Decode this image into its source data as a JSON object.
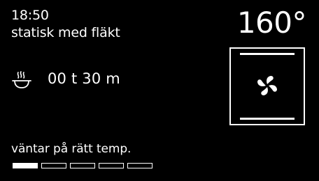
{
  "status_bar": {
    "time": "18:50",
    "mode": "statisk med fläkt",
    "temperature": "160°"
  },
  "timer": {
    "icon": "cooking-pot-steam-icon",
    "duration": "00 t 30 m"
  },
  "oven_display": {
    "heating_icon": "fan-icon",
    "top_element_on": true,
    "bottom_element_on": true
  },
  "footer": {
    "status_text": "väntar på rätt temp.",
    "progress_segments_total": 5,
    "progress_segments_filled": 1
  },
  "colors": {
    "background": "#000000",
    "foreground": "#ffffff"
  }
}
